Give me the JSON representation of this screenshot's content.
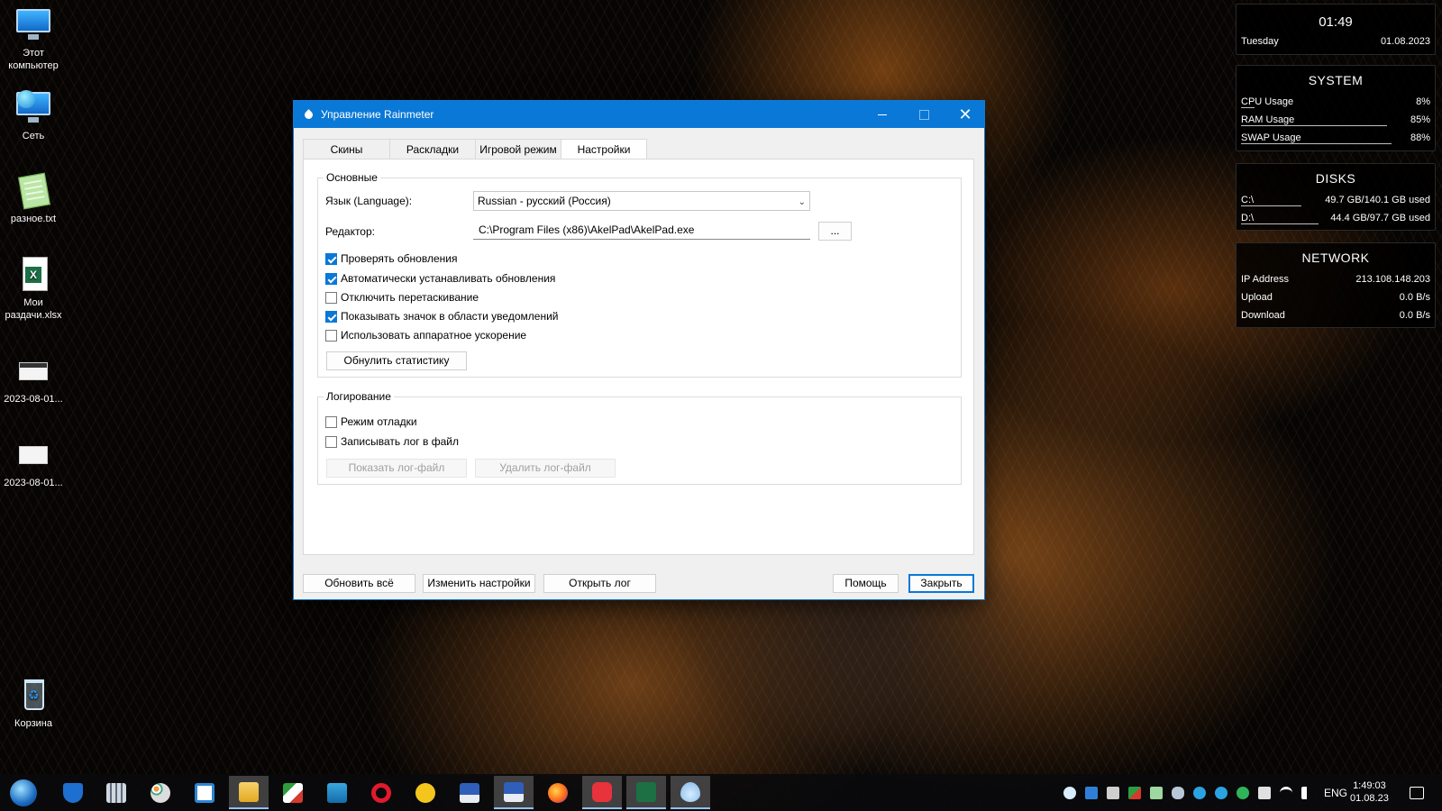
{
  "desktop": {
    "icons": [
      {
        "label": "Этот компьютер"
      },
      {
        "label": "Сеть"
      },
      {
        "label": "разное.txt"
      },
      {
        "label": "Мои раздачи.xlsx"
      },
      {
        "label": "2023-08-01..."
      },
      {
        "label": "2023-08-01..."
      },
      {
        "label": "Корзина"
      }
    ]
  },
  "widgets": {
    "clock": {
      "time": "01:49",
      "day": "Tuesday",
      "date": "01.08.2023"
    },
    "system": {
      "title": "SYSTEM",
      "rows": [
        {
          "label": "CPU Usage",
          "value": "8%",
          "fill": 0.08
        },
        {
          "label": "RAM Usage",
          "value": "85%",
          "fill": 0.85
        },
        {
          "label": "SWAP Usage",
          "value": "88%",
          "fill": 0.88
        }
      ]
    },
    "disks": {
      "title": "DISKS",
      "rows": [
        {
          "label": "C:\\",
          "value": "49.7 GB/140.1 GB used",
          "fill": 0.35
        },
        {
          "label": "D:\\",
          "value": "44.4 GB/97.7 GB used",
          "fill": 0.45
        }
      ]
    },
    "network": {
      "title": "NETWORK",
      "rows": [
        {
          "label": "IP Address",
          "value": "213.108.148.203"
        },
        {
          "label": "Upload",
          "value": "0.0 B/s"
        },
        {
          "label": "Download",
          "value": "0.0 B/s"
        }
      ]
    }
  },
  "window": {
    "title": "Управление Rainmeter",
    "tabs": [
      "Скины",
      "Раскладки",
      "Игровой режим",
      "Настройки"
    ],
    "active_tab": "Настройки",
    "basic": {
      "group_label": "Основные",
      "language_label": "Язык (Language):",
      "language_value": "Russian - русский (Россия)",
      "editor_label": "Редактор:",
      "editor_value": "C:\\Program Files (x86)\\AkelPad\\AkelPad.exe",
      "browse_label": "...",
      "checkboxes": [
        {
          "label": "Проверять обновления",
          "checked": true
        },
        {
          "label": "Автоматически устанавливать обновления",
          "checked": true
        },
        {
          "label": "Отключить перетаскивание",
          "checked": false
        },
        {
          "label": "Показывать значок в области уведомлений",
          "checked": true
        },
        {
          "label": "Использовать аппаратное ускорение",
          "checked": false
        }
      ],
      "reset_stats_label": "Обнулить статистику"
    },
    "logging": {
      "group_label": "Логирование",
      "checkboxes": [
        {
          "label": "Режим отладки",
          "checked": false
        },
        {
          "label": "Записывать лог в файл",
          "checked": false
        }
      ],
      "show_log_label": "Показать лог-файл",
      "delete_log_label": "Удалить лог-файл"
    },
    "footer": {
      "refresh_all": "Обновить всё",
      "edit_settings": "Изменить настройки",
      "open_log": "Открыть лог",
      "help": "Помощь",
      "close": "Закрыть"
    }
  },
  "taskbar": {
    "language": "ENG",
    "time": "1:49:03",
    "date": "01.08.23",
    "accent": "#0a78d7"
  }
}
